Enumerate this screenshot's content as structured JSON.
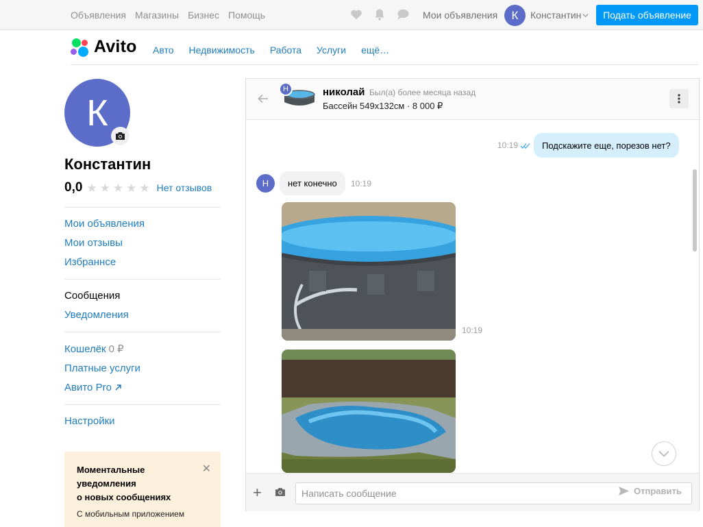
{
  "topbar": {
    "nav": [
      "Объявления",
      "Магазины",
      "Бизнес",
      "Помощь"
    ],
    "icons": [
      "heart-icon",
      "bell-icon",
      "chat-icon"
    ],
    "my_ads": "Мои объявления",
    "avatar_letter": "К",
    "username": "Константин",
    "post_button": "Подать объявление"
  },
  "header": {
    "logo_text": "Avito",
    "categories": [
      "Авто",
      "Недвижимость",
      "Работа",
      "Услуги",
      "ещё…"
    ]
  },
  "sidebar": {
    "avatar_letter": "К",
    "name": "Константин",
    "rating": "0,0",
    "stars": 5,
    "no_reviews": "Нет отзывов",
    "group1": [
      "Мои объявления",
      "Мои отзывы",
      "Избраннсе"
    ],
    "group2": [
      "Сообщения",
      "Уведомления"
    ],
    "wallet_label": "Кошелёк",
    "wallet_value": "0 ₽",
    "paid_services": "Платные услуги",
    "avito_pro": "Авито Pro",
    "settings": "Настройки",
    "promo": {
      "title_lines": [
        "Моментальные",
        "уведомления",
        "о новых сообщениях"
      ],
      "text": "С мобильным приложением"
    }
  },
  "chat": {
    "peer_letter": "Н",
    "peer_name": "николай",
    "peer_status": "Был(а) более месяца назад",
    "item_info": "Бассейн 549x132см · 8 000 ₽",
    "messages": [
      {
        "dir": "out",
        "text": "Подскажите еще, порезов нет?",
        "time": "10:19"
      },
      {
        "dir": "in",
        "text": "нет конечно",
        "time": "10:19"
      },
      {
        "dir": "in",
        "type": "photo",
        "time": "10:19"
      }
    ],
    "input_placeholder": "Написать сообщение",
    "send_label": "Отправить"
  },
  "colors": {
    "accent": "#0099f7",
    "link": "#1f7dbe",
    "avatar": "#5b6dc8",
    "bubble_out": "#d6efff",
    "bubble_in": "#f2f2f2",
    "promo_bg": "#fdf1dd"
  }
}
